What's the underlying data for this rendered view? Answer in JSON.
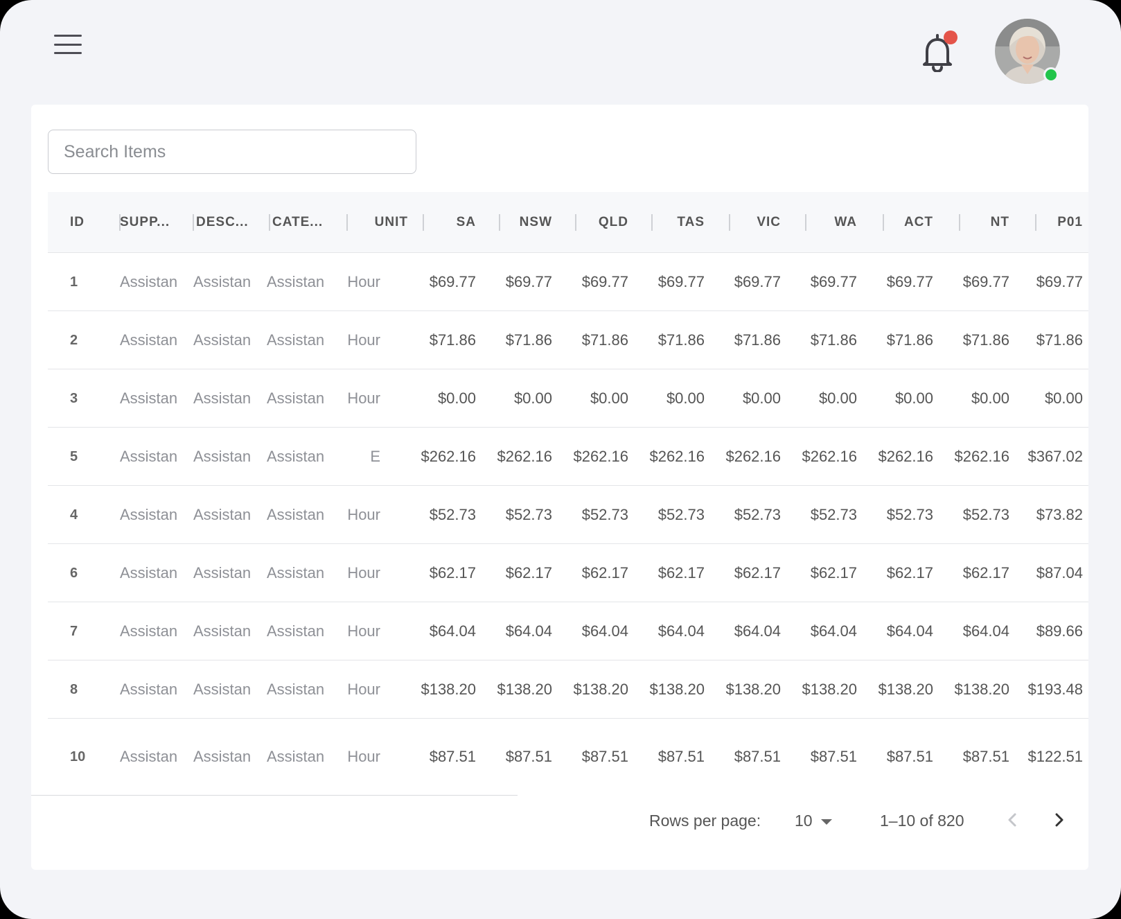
{
  "search": {
    "placeholder": "Search Items"
  },
  "table": {
    "columns": [
      "ID",
      "SUPP...",
      "DESC...",
      "CATE...",
      "UNIT",
      "SA",
      "NSW",
      "QLD",
      "TAS",
      "VIC",
      "WA",
      "ACT",
      "NT",
      "P01"
    ],
    "rows": [
      {
        "id": "1",
        "supp": "Assistan",
        "desc": "Assistan",
        "cate": "Assistan",
        "unit": "Hour",
        "prices": [
          "$69.77",
          "$69.77",
          "$69.77",
          "$69.77",
          "$69.77",
          "$69.77",
          "$69.77",
          "$69.77",
          "$69.77"
        ]
      },
      {
        "id": "2",
        "supp": "Assistan",
        "desc": "Assistan",
        "cate": "Assistan",
        "unit": "Hour",
        "prices": [
          "$71.86",
          "$71.86",
          "$71.86",
          "$71.86",
          "$71.86",
          "$71.86",
          "$71.86",
          "$71.86",
          "$71.86"
        ]
      },
      {
        "id": "3",
        "supp": "Assistan",
        "desc": "Assistan",
        "cate": "Assistan",
        "unit": "Hour",
        "prices": [
          "$0.00",
          "$0.00",
          "$0.00",
          "$0.00",
          "$0.00",
          "$0.00",
          "$0.00",
          "$0.00",
          "$0.00"
        ]
      },
      {
        "id": "5",
        "supp": "Assistan",
        "desc": "Assistan",
        "cate": "Assistan",
        "unit": "E",
        "prices": [
          "$262.16",
          "$262.16",
          "$262.16",
          "$262.16",
          "$262.16",
          "$262.16",
          "$262.16",
          "$262.16",
          "$367.02"
        ]
      },
      {
        "id": "4",
        "supp": "Assistan",
        "desc": "Assistan",
        "cate": "Assistan",
        "unit": "Hour",
        "prices": [
          "$52.73",
          "$52.73",
          "$52.73",
          "$52.73",
          "$52.73",
          "$52.73",
          "$52.73",
          "$52.73",
          "$73.82"
        ]
      },
      {
        "id": "6",
        "supp": "Assistan",
        "desc": "Assistan",
        "cate": "Assistan",
        "unit": "Hour",
        "prices": [
          "$62.17",
          "$62.17",
          "$62.17",
          "$62.17",
          "$62.17",
          "$62.17",
          "$62.17",
          "$62.17",
          "$87.04"
        ]
      },
      {
        "id": "7",
        "supp": "Assistan",
        "desc": "Assistan",
        "cate": "Assistan",
        "unit": "Hour",
        "prices": [
          "$64.04",
          "$64.04",
          "$64.04",
          "$64.04",
          "$64.04",
          "$64.04",
          "$64.04",
          "$64.04",
          "$89.66"
        ]
      },
      {
        "id": "8",
        "supp": "Assistan",
        "desc": "Assistan",
        "cate": "Assistan",
        "unit": "Hour",
        "prices": [
          "$138.20",
          "$138.20",
          "$138.20",
          "$138.20",
          "$138.20",
          "$138.20",
          "$138.20",
          "$138.20",
          "$193.48"
        ]
      },
      {
        "id": "10",
        "supp": "Assistan",
        "desc": "Assistan",
        "cate": "Assistan",
        "unit": "Hour",
        "prices": [
          "$87.51",
          "$87.51",
          "$87.51",
          "$87.51",
          "$87.51",
          "$87.51",
          "$87.51",
          "$87.51",
          "$122.51"
        ]
      }
    ]
  },
  "pagination": {
    "rows_per_page_label": "Rows per page:",
    "rows_per_page_value": "10",
    "range": "1–10 of 820"
  },
  "header": {
    "notification_badge_color": "#e4544a",
    "online_status_color": "#22c44a"
  }
}
